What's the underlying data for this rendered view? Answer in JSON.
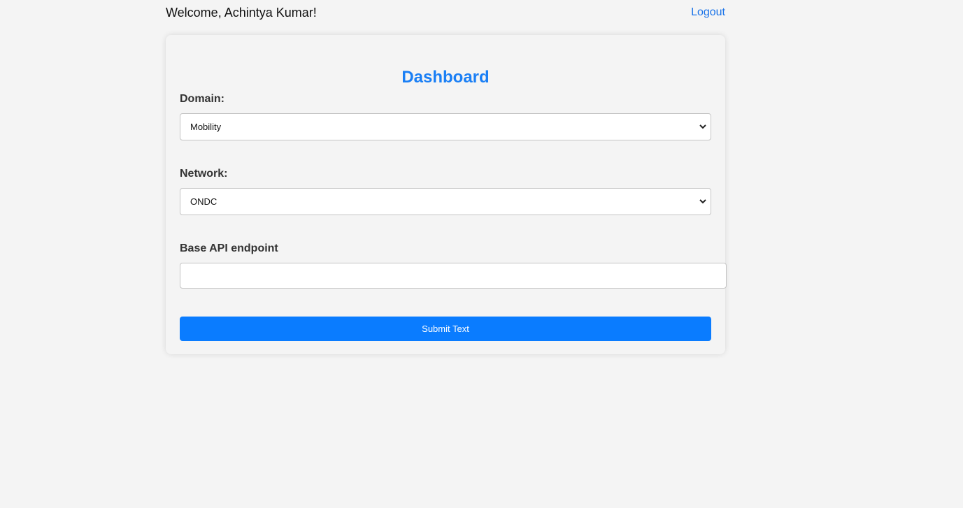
{
  "header": {
    "welcome_text": "Welcome, Achintya Kumar!",
    "logout_label": "Logout"
  },
  "card": {
    "title": "Dashboard",
    "domain": {
      "label": "Domain:",
      "selected": "Mobility"
    },
    "network": {
      "label": "Network:",
      "selected": "ONDC"
    },
    "base_api": {
      "label": "Base API endpoint",
      "value": ""
    },
    "submit_label": "Submit Text"
  },
  "colors": {
    "accent": "#0a7cff",
    "title": "#1a7ff5",
    "link": "#1a73e8",
    "background": "#f4f4f4"
  },
  "icons": [
    "chevron-down-icon"
  ]
}
